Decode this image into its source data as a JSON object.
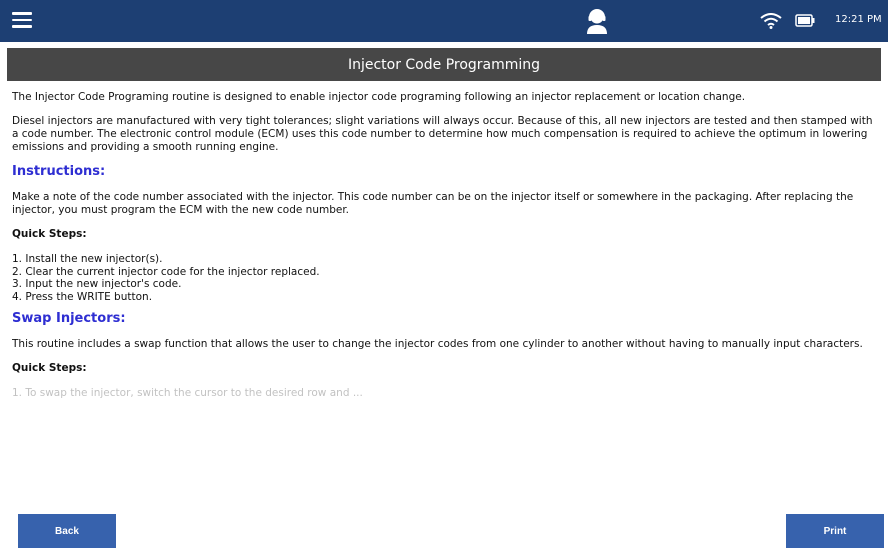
{
  "statusbar": {
    "time": "12:21 PM",
    "icons": [
      "menu-icon",
      "agent-icon",
      "wifi-icon",
      "battery-icon"
    ]
  },
  "title": "Injector Code Programming",
  "content": {
    "intro": "The Injector Code Programing routine is designed to enable injector code programing following an injector replacement or location change.",
    "description": "Diesel injectors are manufactured with very tight tolerances; slight variations will always occur. Because of this, all new injectors are tested and then stamped with a code number. The electronic control module (ECM) uses this code number to determine how much compensation is required to achieve the optimum in lowering emissions and providing a smooth running engine.",
    "instructions": {
      "heading": "Instructions:",
      "text": "Make a note of the code number associated with the injector. This code number can be on the injector itself or somewhere in the packaging. After replacing the injector, you must program the ECM with the new code number.",
      "quick_steps_heading": "Quick Steps:",
      "steps": [
        "1. Install the new injector(s).",
        "2. Clear the current injector code for the injector replaced.",
        "3. Input the new injector's code.",
        "4. Press the WRITE button."
      ]
    },
    "swap": {
      "heading": "Swap Injectors:",
      "text": "This routine includes a swap function that allows the user to change the injector codes from one cylinder to another without having to manually input characters.",
      "quick_steps_heading": "Quick Steps:",
      "partial_step": "1. To swap the injector, switch the cursor to the desired row and ..."
    }
  },
  "buttons": {
    "back": "Back",
    "print": "Print"
  },
  "colors": {
    "statusbar": "#1d3f73",
    "titlebar": "#474747",
    "section_heading": "#2e2ed2",
    "button": "#3762ad"
  }
}
